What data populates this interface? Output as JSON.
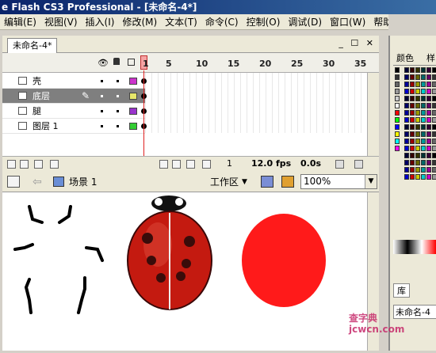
{
  "window": {
    "title": "e Flash CS3 Professional - [未命名-4*]"
  },
  "menu": [
    "编辑(E)",
    "视图(V)",
    "插入(I)",
    "修改(M)",
    "文本(T)",
    "命令(C)",
    "控制(O)",
    "调试(D)",
    "窗口(W)",
    "帮助(H)"
  ],
  "document": {
    "tab_label": "未命名-4*",
    "tab_controls": "_ ☐ ✕"
  },
  "timeline": {
    "frame_numbers": [
      "1",
      "5",
      "10",
      "15",
      "20",
      "25",
      "30",
      "35"
    ],
    "layers": [
      {
        "name": "壳",
        "color": "#cc33cc",
        "selected": false
      },
      {
        "name": "底层",
        "color": "#e6e66a",
        "selected": true
      },
      {
        "name": "腿",
        "color": "#9933cc",
        "selected": false
      },
      {
        "name": "图层 1",
        "color": "#33cc33",
        "selected": false
      }
    ],
    "footer": {
      "current_frame": "1",
      "fps": "12.0 fps",
      "time": "0.0s"
    }
  },
  "edit_bar": {
    "scene_label": "场景 1",
    "workspace_label": "工作区",
    "zoom": "100%"
  },
  "right_panel": {
    "tabs": [
      "颜色",
      "样"
    ],
    "library_tab": "库",
    "library_name": "未命名-4"
  },
  "watermark": {
    "line1": "查字典",
    "line2": "jcwcn.com"
  },
  "colors": {
    "ladybug_body": "#c41a10",
    "circle": "#ff1a1a",
    "accent": "#0a246a"
  }
}
